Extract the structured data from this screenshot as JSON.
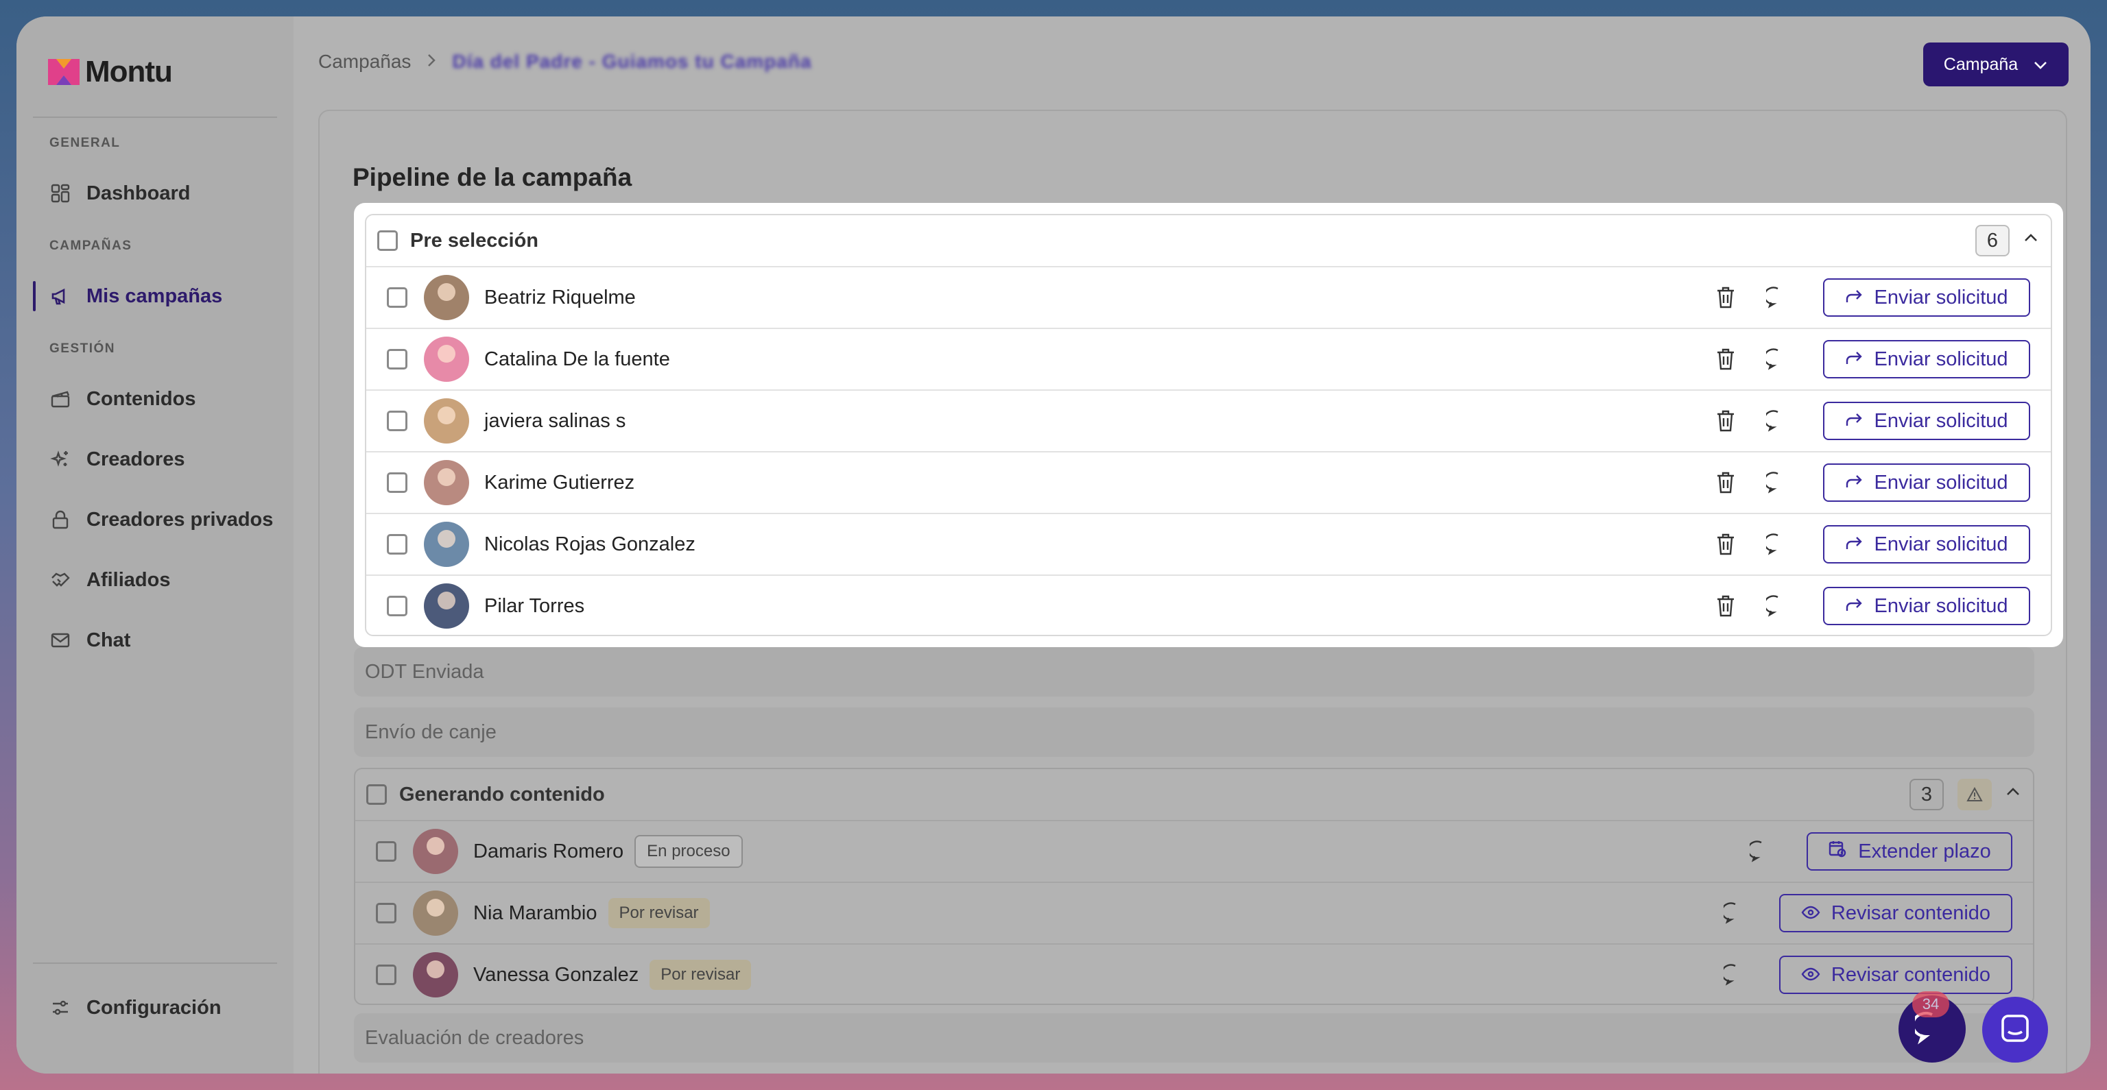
{
  "brand": {
    "name": "Montu"
  },
  "sidebar": {
    "sections": [
      {
        "label": "GENERAL",
        "items": [
          {
            "label": "Dashboard",
            "icon": "grid-icon"
          }
        ]
      },
      {
        "label": "CAMPAÑAS",
        "items": [
          {
            "label": "Mis campañas",
            "icon": "megaphone-icon",
            "active": true
          }
        ]
      },
      {
        "label": "GESTIÓN",
        "items": [
          {
            "label": "Contenidos",
            "icon": "clapperboard-icon"
          },
          {
            "label": "Creadores",
            "icon": "sparkles-icon"
          },
          {
            "label": "Creadores privados",
            "icon": "lock-icon"
          },
          {
            "label": "Afiliados",
            "icon": "handshake-icon"
          },
          {
            "label": "Chat",
            "icon": "mail-icon"
          }
        ]
      }
    ],
    "footer": {
      "label": "Configuración",
      "icon": "sliders-icon"
    }
  },
  "header": {
    "breadcrumb_root": "Campañas",
    "breadcrumb_current": "Día del Padre - Guiamos tu Campaña",
    "campaign_button": "Campaña"
  },
  "panel": {
    "title": "Pipeline de la campaña",
    "preselection": {
      "title": "Pre selección",
      "count": "6",
      "action_label": "Enviar solicitud",
      "rows": [
        {
          "name": "Beatriz Riquelme"
        },
        {
          "name": "Catalina De la fuente"
        },
        {
          "name": "javiera salinas s"
        },
        {
          "name": "Karime Gutierrez"
        },
        {
          "name": "Nicolas Rojas Gonzalez"
        },
        {
          "name": "Pilar Torres"
        }
      ]
    },
    "stages": {
      "odt": "ODT Enviada",
      "canje": "Envío de canje",
      "evaluacion": "Evaluación de creadores"
    },
    "generating": {
      "title": "Generando contenido",
      "count": "3",
      "rows": [
        {
          "name": "Damaris Romero",
          "badge": "En proceso",
          "action": "Extender plazo"
        },
        {
          "name": "Nia Marambio",
          "badge": "Por revisar",
          "action": "Revisar contenido"
        },
        {
          "name": "Vanessa Gonzalez",
          "badge": "Por revisar",
          "action": "Revisar contenido"
        }
      ]
    }
  },
  "chat_widget": {
    "badge": "34"
  },
  "colors": {
    "primary": "#2a1670",
    "accent": "#3b2a9e",
    "badge": "#e4495b"
  }
}
